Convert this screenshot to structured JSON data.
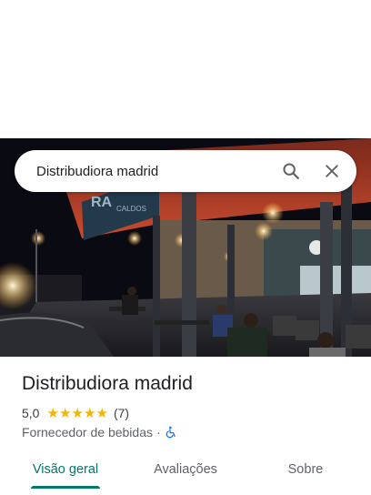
{
  "search": {
    "query": "Distribudiora madrid",
    "search_icon": "search-icon",
    "close_icon": "close-icon"
  },
  "hero": {
    "image": "storefront-photo"
  },
  "place": {
    "title": "Distribudiora madrid",
    "rating": "5,0",
    "stars": 5,
    "review_count": "(7)",
    "category": "Fornecedor de bebidas",
    "separator": "·",
    "accessibility_icon": "wheelchair-icon"
  },
  "tabs": [
    {
      "label": "Visão geral",
      "active": true
    },
    {
      "label": "Avaliações",
      "active": false
    },
    {
      "label": "Sobre",
      "active": false
    }
  ],
  "colors": {
    "accent": "#00796b",
    "star": "#f5b400",
    "accessibility": "#1a73e8"
  }
}
